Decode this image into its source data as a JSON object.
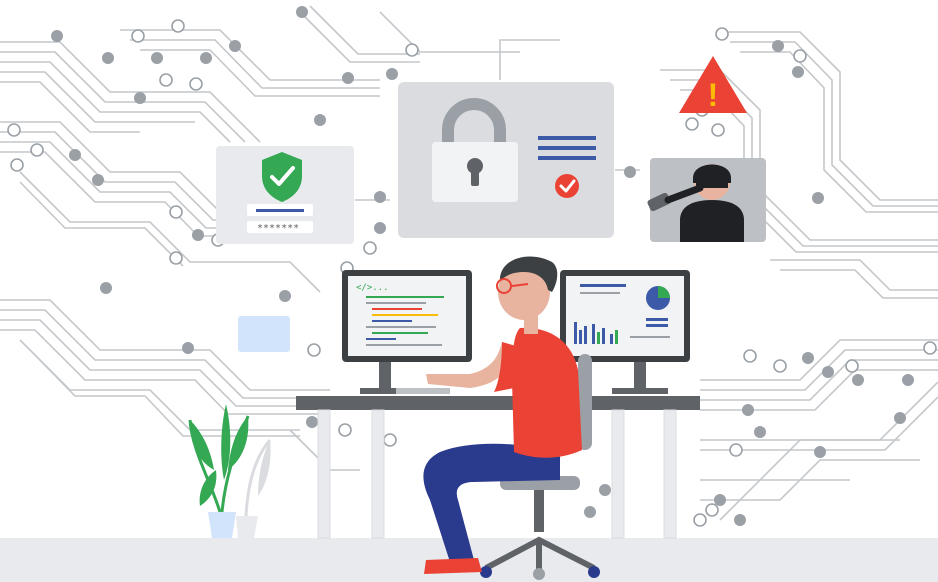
{
  "scene": {
    "description_free": true,
    "login_card": {
      "password_mask": "*******",
      "shield_icon": "shield-check-icon"
    },
    "lock_card": {
      "lock_icon": "padlock-icon",
      "status_icon": "check-circle-icon"
    },
    "warning": {
      "icon": "warning-triangle-icon",
      "glyph": "!"
    },
    "hacker_card": {
      "icon": "hacker-binoculars-icon"
    },
    "left_monitor": {
      "code_tag": "</>..."
    },
    "colors": {
      "circuit": "#c4c7ca",
      "node": "#9aa0a6",
      "card": "#e8eaed",
      "shield": "#34a853",
      "check_red": "#ea4335",
      "warning": "#ea4335",
      "accent_blue": "#3c5aa8",
      "shirt": "#ea4335",
      "pants": "#2a3a8c",
      "desk": "#5f6368",
      "floor": "#e8eaed",
      "plant": "#34a853",
      "pie_green": "#34a853",
      "pie_blue": "#3c5aa8"
    }
  }
}
